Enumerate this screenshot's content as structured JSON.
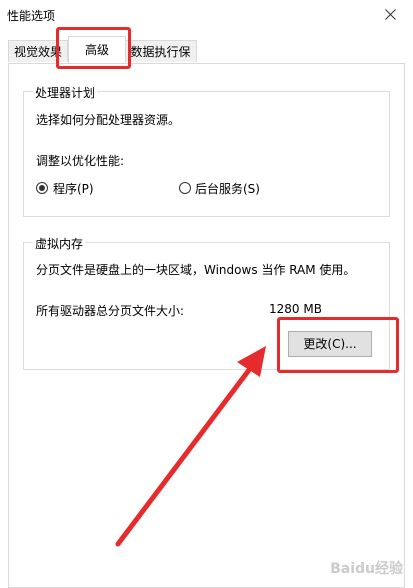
{
  "window": {
    "title": "性能选项"
  },
  "tabs": [
    {
      "label": "视觉效果"
    },
    {
      "label": "高级"
    },
    {
      "label": "数据执行保护"
    }
  ],
  "processor_scheduling": {
    "title": "处理器计划",
    "description": "选择如何分配处理器资源。",
    "adjust_label": "调整以优化性能:",
    "options": [
      {
        "label": "程序(P)",
        "selected": true
      },
      {
        "label": "后台服务(S)",
        "selected": false
      }
    ]
  },
  "virtual_memory": {
    "title": "虚拟内存",
    "description": "分页文件是硬盘上的一块区域，Windows 当作 RAM 使用。",
    "total_label": "所有驱动器总分页文件大小:",
    "total_value": "1280 MB",
    "change_button": "更改(C)..."
  },
  "annotation": {
    "color": "#e52b2b"
  },
  "watermark": {
    "text": "Baidu经验"
  }
}
